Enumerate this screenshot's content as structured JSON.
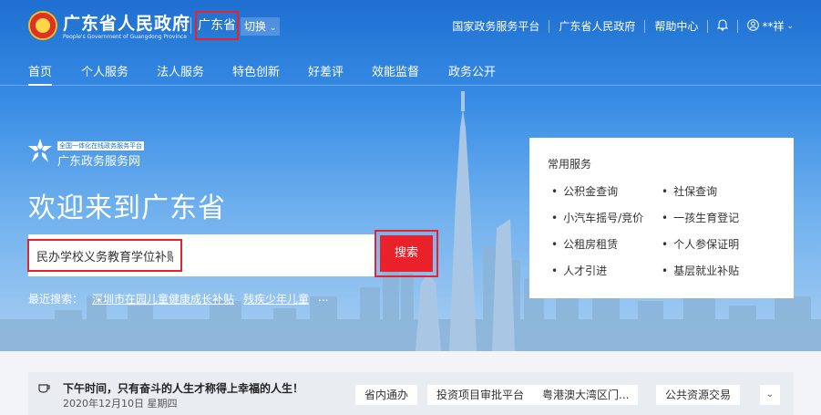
{
  "header": {
    "gov_name": "广东省人民政府",
    "gov_en": "People's Government of Guangdong Province",
    "region": "广东省",
    "switch_label": "切换",
    "links": [
      "国家政务服务平台",
      "广东省人民政府",
      "帮助中心"
    ],
    "user": "**祥"
  },
  "nav": {
    "items": [
      "首页",
      "个人服务",
      "法人服务",
      "特色创新",
      "好差评",
      "效能监督",
      "政务公开"
    ],
    "active": "首页"
  },
  "brand": {
    "tag": "全国一体化在线政务服务平台",
    "name": "广东政务服务网",
    "welcome": "欢迎来到广东省"
  },
  "search": {
    "value": "民办学校义务教育学位补贴",
    "button": "搜索",
    "recent_label": "最近搜索：",
    "recent": [
      "深圳市在园儿童健康成长补贴",
      "残疾少年儿童",
      "..."
    ]
  },
  "services": {
    "title": "常用服务",
    "items": [
      "公积金查询",
      "社保查询",
      "小汽车摇号/竞价",
      "一孩生育登记",
      "公租房租赁",
      "个人参保证明",
      "人才引进",
      "基层就业补贴"
    ]
  },
  "bottom": {
    "motto": "下午时间，只有奋斗的人生才称得上幸福的人生！",
    "date": "2020年12月10日 星期四",
    "quick_links": [
      "省内通办",
      "投资项目审批平台",
      "粤港澳大湾区门...",
      "公共资源交易"
    ]
  },
  "colors": {
    "primary": "#1e6fd0",
    "accent": "#e8212a"
  },
  "icons": [
    "bell-icon",
    "user-icon",
    "chevron-down-icon",
    "cup-icon",
    "emblem-icon",
    "brand-logo-icon"
  ]
}
